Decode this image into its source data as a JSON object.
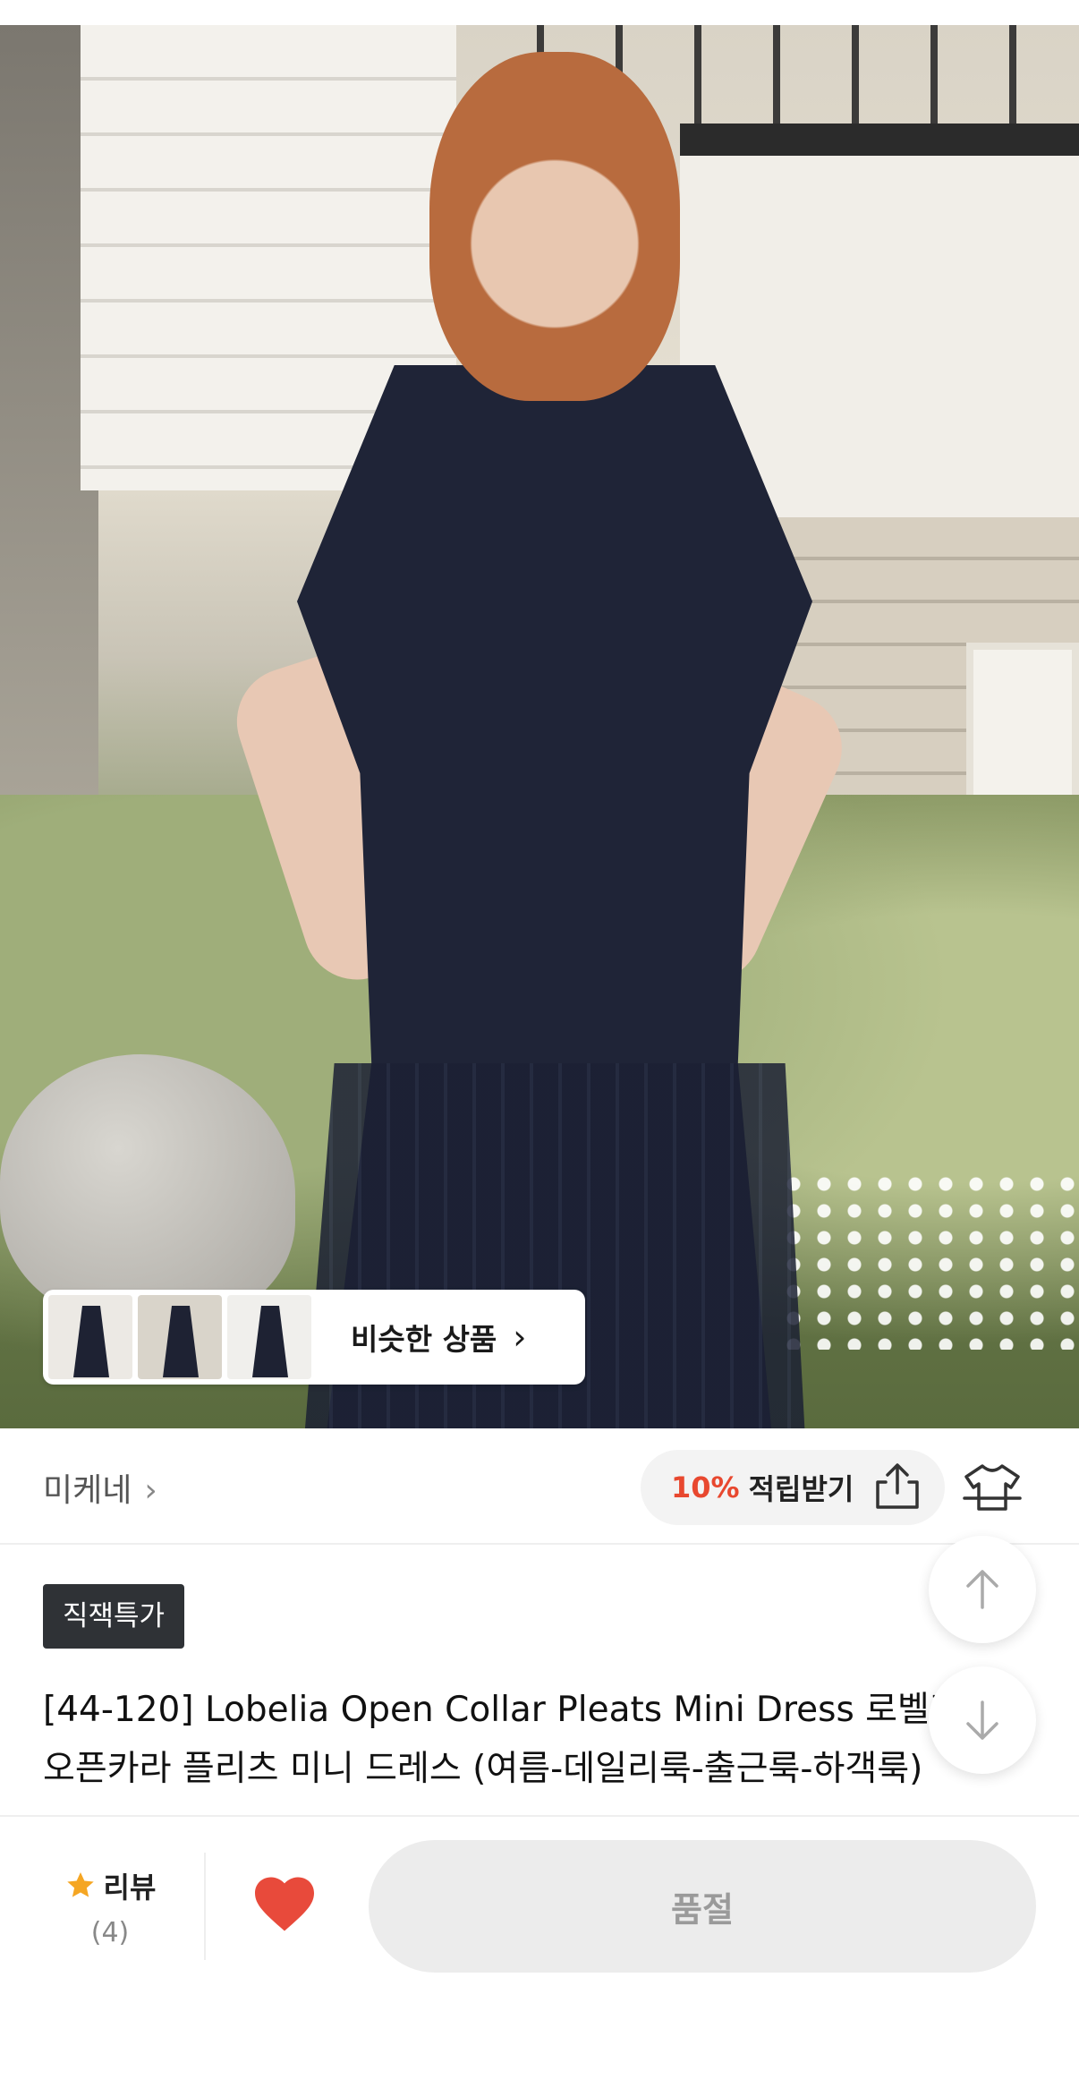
{
  "similar": {
    "label": "비슷한 상품",
    "arrow": "›"
  },
  "brand": {
    "name": "미케네",
    "chevron": "›"
  },
  "reward": {
    "percent": "10%",
    "label": "적립받기"
  },
  "badge": {
    "label": "직잭특가"
  },
  "product": {
    "title": "[44-120]  Lobelia Open Collar Pleats Mini Dress  로벨리아 오픈카라 플리츠 미니 드레스 (여름-데일리룩-출근룩-하객룩)"
  },
  "bottom_bar": {
    "review_label": "리뷰",
    "review_count": "(4)",
    "soldout_label": "품절"
  },
  "colors": {
    "accent_red": "#e8482f",
    "heart_red": "#e84a3b",
    "star_orange": "#f5a623",
    "badge_bg": "#2f3236"
  },
  "icons": [
    "share-icon",
    "fit-guide-icon",
    "arrow-up-icon",
    "arrow-down-icon",
    "star-icon",
    "heart-icon",
    "chevron-right-icon"
  ]
}
